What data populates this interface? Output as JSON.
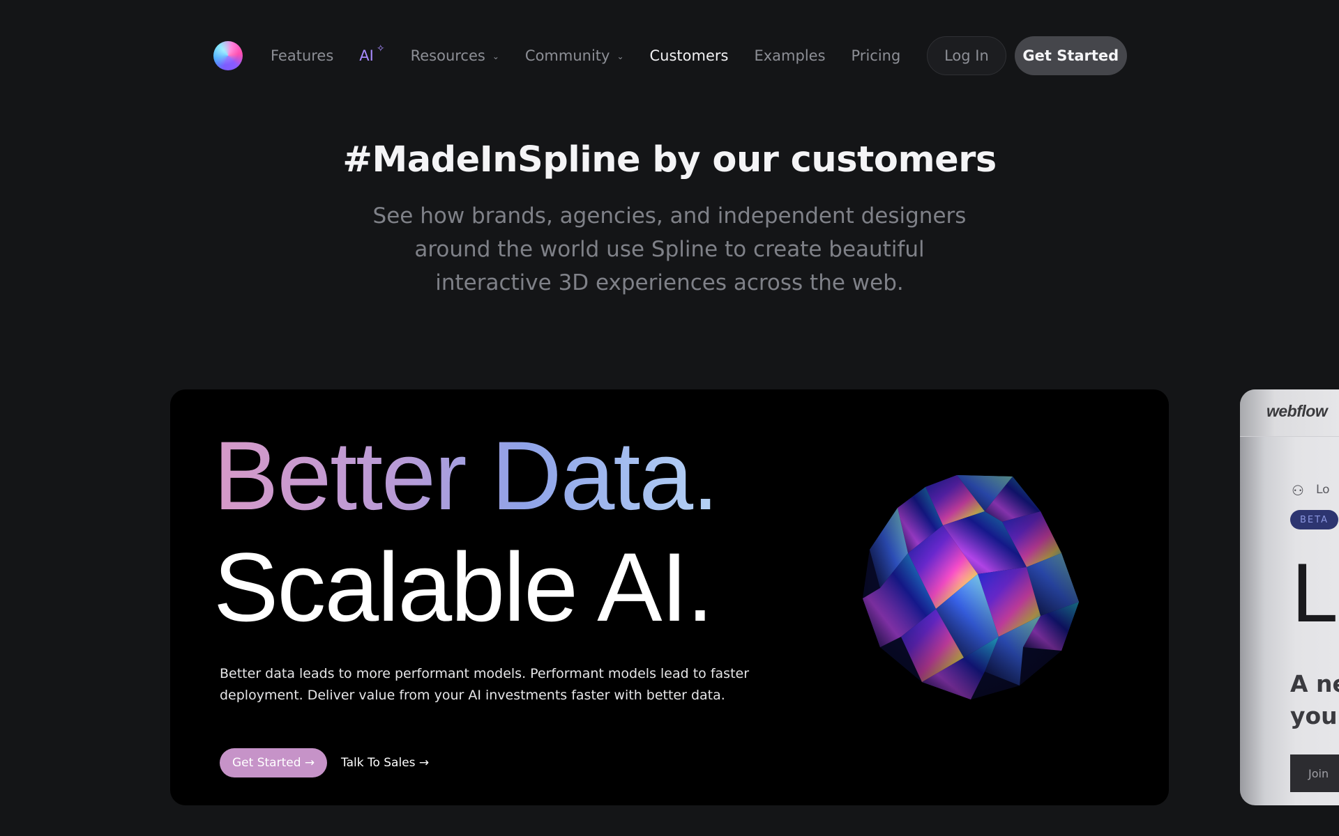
{
  "nav": {
    "logo_name": "spline-logo",
    "items": [
      {
        "label": "Features",
        "state": "default"
      },
      {
        "label": "AI",
        "state": "ai",
        "icon": "sparkle-icon"
      },
      {
        "label": "Resources",
        "state": "default",
        "icon": "chevron-down-icon"
      },
      {
        "label": "Community",
        "state": "default",
        "icon": "chevron-down-icon"
      },
      {
        "label": "Customers",
        "state": "active"
      },
      {
        "label": "Examples",
        "state": "default"
      },
      {
        "label": "Pricing",
        "state": "default"
      }
    ],
    "login_label": "Log In",
    "get_started_label": "Get Started"
  },
  "hero": {
    "title": "#MadeInSpline by our customers",
    "subtitle": "See how brands, agencies, and independent designers around the world use Spline to create beautiful interactive 3D experiences across the web."
  },
  "feature_card": {
    "headline_1": "Better Data.",
    "headline_2": "Scalable AI.",
    "description": "Better data leads to more performant models. Performant models lead to faster deployment. Deliver value from your AI investments faster with better data.",
    "primary_cta": "Get Started →",
    "secondary_cta": "Talk To Sales →",
    "gradient_colors": [
      "#d79ac8",
      "#b79bd7",
      "#8fa3e8",
      "#b6d3f5"
    ],
    "primary_cta_color": "#c693c8"
  },
  "side_card": {
    "brand": "webflow",
    "login_fragment": "Lo",
    "badge": "BETA",
    "big_letter": "L",
    "text_fragment": "A ne\nyou",
    "button_fragment": "Join"
  },
  "colors": {
    "background": "#141517",
    "ai_accent": "#a88bff",
    "get_started_bg": "#45464b"
  }
}
